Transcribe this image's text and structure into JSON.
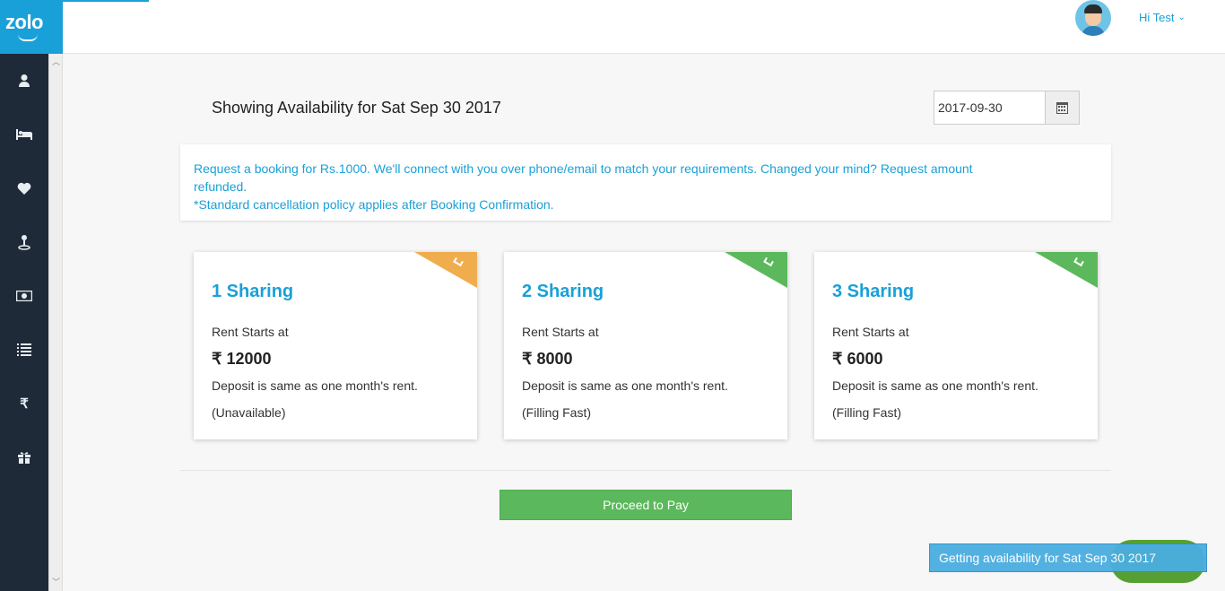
{
  "brand": {
    "logo_text": "zolo",
    "accent": "#1aa0d8"
  },
  "header": {
    "greeting": "Hi Test",
    "chevron_icon": "chevron-down-icon"
  },
  "sidebar": {
    "items": [
      {
        "icon": "user-icon",
        "glyph": "👤"
      },
      {
        "icon": "bed-icon",
        "glyph": "🛏"
      },
      {
        "icon": "heart-icon",
        "glyph": "♥"
      },
      {
        "icon": "map-pin-icon",
        "glyph": "⚲"
      },
      {
        "icon": "money-icon",
        "glyph": "💵"
      },
      {
        "icon": "list-icon",
        "glyph": "☰"
      },
      {
        "icon": "rupee-icon",
        "glyph": "₹"
      },
      {
        "icon": "gift-icon",
        "glyph": "🎁"
      }
    ]
  },
  "main": {
    "title": "Showing Availability for Sat Sep 30 2017",
    "date_value": "2017-09-30",
    "info_line1": "Request a booking for Rs.1000. We'll connect with you over phone/email to match your requirements. Changed your mind? Request amount refunded.",
    "info_line2": "*Standard cancellation policy applies after Booking Confirmation.",
    "cards": [
      {
        "title": "1 Sharing",
        "rent_label": "Rent Starts at",
        "price": "₹ 12000",
        "deposit": "Deposit is same as one month's rent.",
        "status": "(Unavailable)",
        "ribbon_color": "#f0ad4e"
      },
      {
        "title": "2 Sharing",
        "rent_label": "Rent Starts at",
        "price": "₹ 8000",
        "deposit": "Deposit is same as one month's rent.",
        "status": "(Filling Fast)",
        "ribbon_color": "#5cb85c"
      },
      {
        "title": "3 Sharing",
        "rent_label": "Rent Starts at",
        "price": "₹ 6000",
        "deposit": "Deposit is same as one month's rent.",
        "status": "(Filling Fast)",
        "ribbon_color": "#5cb85c"
      }
    ],
    "proceed_label": "Proceed to Pay"
  },
  "toast": {
    "text": "Getting availability for Sat Sep 30 2017"
  }
}
